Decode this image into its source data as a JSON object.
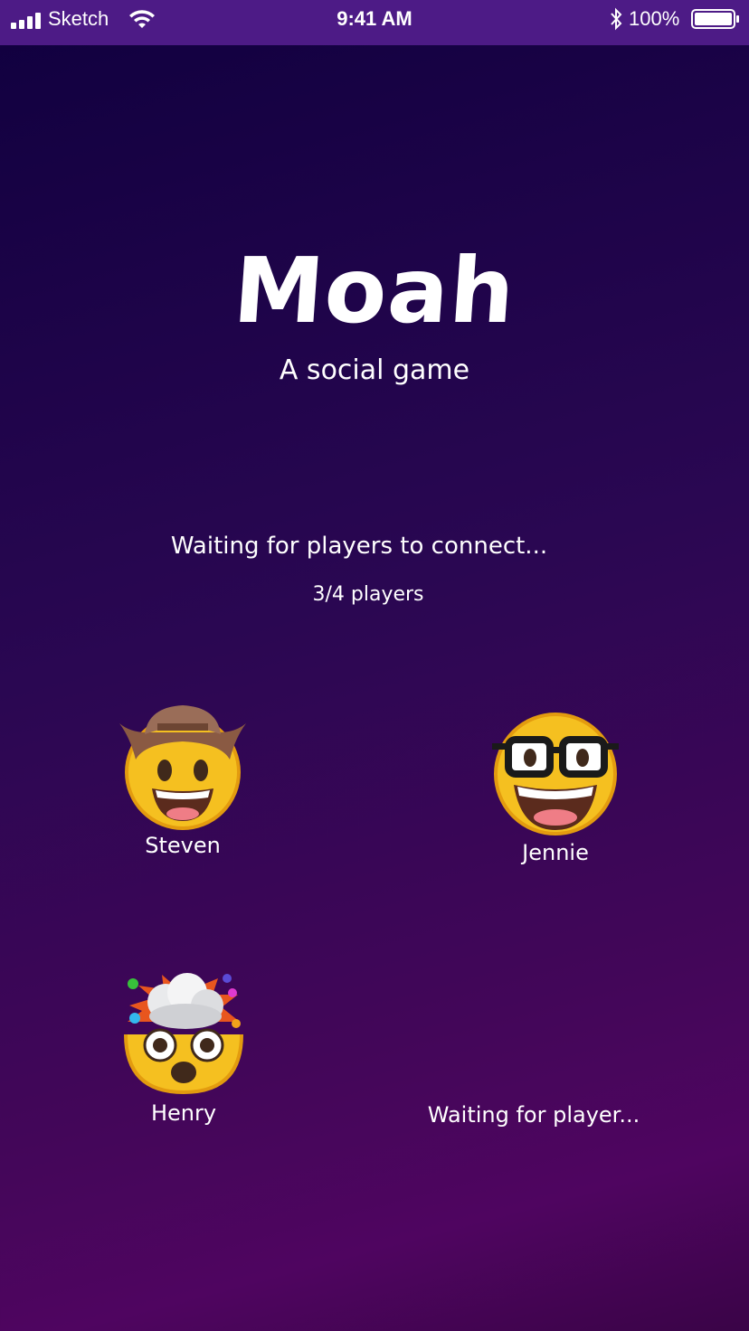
{
  "status_bar": {
    "carrier": "Sketch",
    "time": "9:41 AM",
    "battery": "100%"
  },
  "app": {
    "title": "Moah",
    "subtitle": "A social game"
  },
  "lobby": {
    "status": "Waiting for players to connect...",
    "count": "3/4 players",
    "players": [
      {
        "name": "Steven",
        "emoji": "cowboy-face-icon"
      },
      {
        "name": "Jennie",
        "emoji": "nerd-face-icon"
      },
      {
        "name": "Henry",
        "emoji": "exploding-head-icon"
      },
      {
        "name": "Waiting for player...",
        "emoji": ""
      }
    ]
  }
}
